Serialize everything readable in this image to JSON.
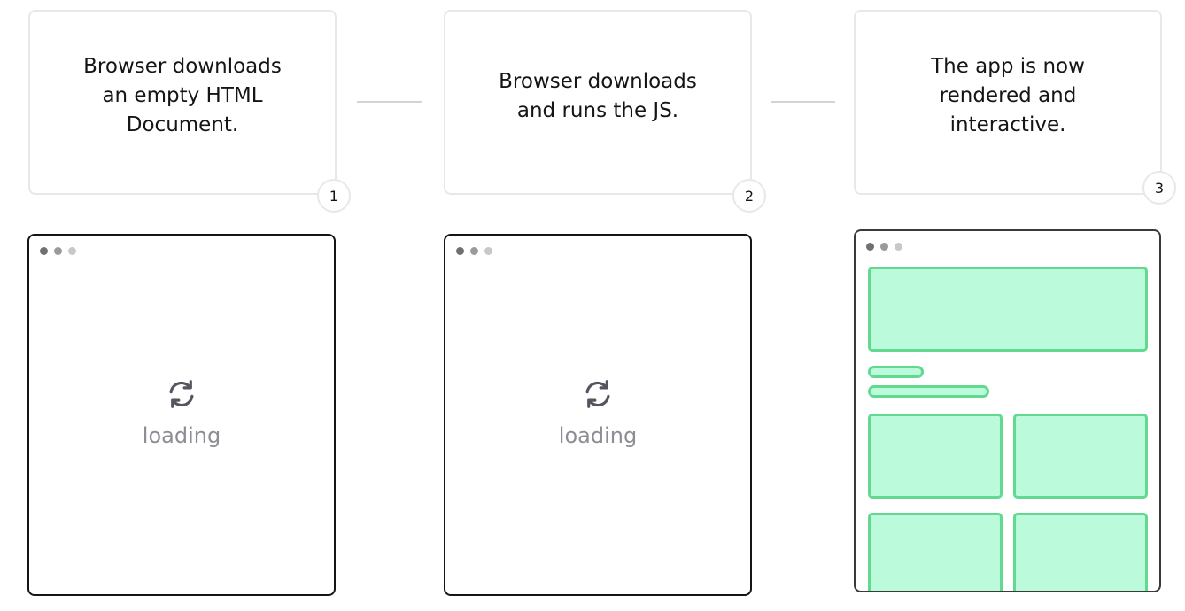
{
  "steps": [
    {
      "text": "Browser downloads\nan empty HTML\nDocument.",
      "number": "1"
    },
    {
      "text": "Browser downloads\nand runs the JS.",
      "number": "2"
    },
    {
      "text": "The app is now\nrendered and\ninteractive.",
      "number": "3"
    }
  ],
  "browsers": [
    {
      "state": "loading",
      "icon": "refresh-icon",
      "loading_text": "loading"
    },
    {
      "state": "loading",
      "icon": "refresh-icon",
      "loading_text": "loading"
    },
    {
      "state": "rendered"
    }
  ],
  "colors": {
    "block_fill": "#bbfbdc",
    "block_border": "#63d98f",
    "card_border": "#e8e8e8",
    "loading_text": "#8d8d96"
  }
}
